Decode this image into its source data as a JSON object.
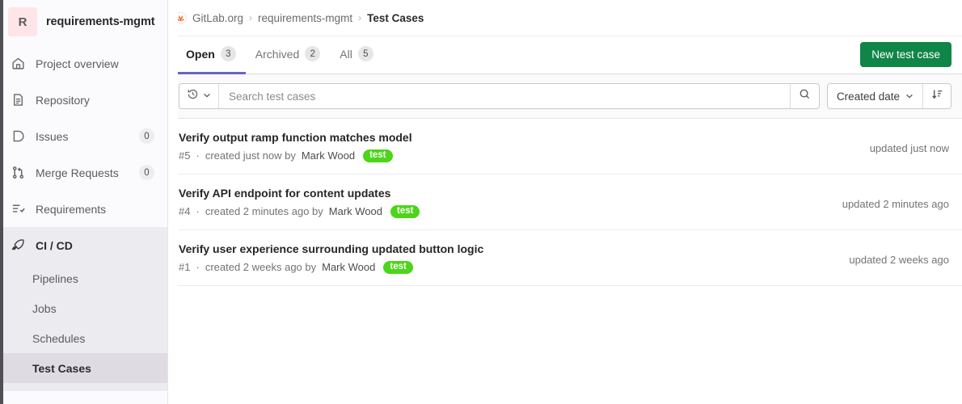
{
  "sidebar": {
    "project": {
      "avatar_initial": "R",
      "name": "requirements-mgmt"
    },
    "items": [
      {
        "label": "Project overview",
        "icon": "home-icon",
        "badge": null
      },
      {
        "label": "Repository",
        "icon": "document-icon",
        "badge": null
      },
      {
        "label": "Issues",
        "icon": "issue-icon",
        "badge": "0"
      },
      {
        "label": "Merge Requests",
        "icon": "merge-request-icon",
        "badge": "0"
      },
      {
        "label": "Requirements",
        "icon": "checklist-icon",
        "badge": null
      }
    ],
    "cicd": {
      "label": "CI / CD",
      "icon": "rocket-icon",
      "sub_items": [
        {
          "label": "Pipelines",
          "current": false
        },
        {
          "label": "Jobs",
          "current": false
        },
        {
          "label": "Schedules",
          "current": false
        },
        {
          "label": "Test Cases",
          "current": true
        }
      ]
    }
  },
  "breadcrumb": {
    "org": "GitLab.org",
    "project": "requirements-mgmt",
    "current": "Test Cases",
    "separator": "›"
  },
  "tabs": [
    {
      "label": "Open",
      "count": "3",
      "active": true
    },
    {
      "label": "Archived",
      "count": "2",
      "active": false
    },
    {
      "label": "All",
      "count": "5",
      "active": false
    }
  ],
  "actions": {
    "new_test_case": "New test case"
  },
  "filters": {
    "history_icon": "history-icon",
    "search_placeholder": "Search test cases",
    "search_value": "",
    "sort_by": "Created date",
    "sort_direction_icon": "sort-descending-icon"
  },
  "test_cases": [
    {
      "title": "Verify output ramp function matches model",
      "id": "#5",
      "separator": "·",
      "created": "created just now by",
      "author": "Mark Wood",
      "label": "test",
      "updated": "updated just now"
    },
    {
      "title": "Verify API endpoint for content updates",
      "id": "#4",
      "separator": "·",
      "created": "created 2 minutes ago by",
      "author": "Mark Wood",
      "label": "test",
      "updated": "updated 2 minutes ago"
    },
    {
      "title": "Verify user experience surrounding updated button logic",
      "id": "#1",
      "separator": "·",
      "created": "created 2 weeks ago by",
      "author": "Mark Wood",
      "label": "test",
      "updated": "updated 2 weeks ago"
    }
  ],
  "colors": {
    "accent_tab": "#6666c4",
    "button_green": "#108548",
    "label_green": "#4cd519",
    "avatar_bg": "#fde5e8"
  }
}
